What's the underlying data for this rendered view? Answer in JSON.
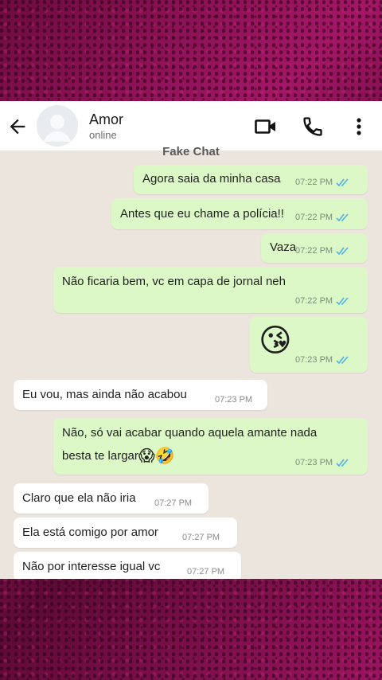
{
  "contact": {
    "name": "Amor",
    "status": "online"
  },
  "overlay_label": "Fake Chat",
  "messages": [
    {
      "dir": "out",
      "text": "Agora saia da minha casa",
      "time": "07:22 PM"
    },
    {
      "dir": "out",
      "text": "Antes que eu chame a polícia!!",
      "time": "07:22 PM"
    },
    {
      "dir": "out",
      "text": "Vaza",
      "time": "07:22 PM"
    },
    {
      "dir": "out",
      "text": "Não ficaria bem, vc em capa de jornal neh",
      "time": "07:22 PM"
    },
    {
      "dir": "out",
      "emoji": "😘",
      "time": "07:23 PM"
    },
    {
      "dir": "in",
      "text": "Eu vou, mas ainda não acabou",
      "time": "07:23 PM"
    },
    {
      "dir": "out",
      "line1": "Não, só vai acabar quando aquela amante nada",
      "line2": "besta te largar",
      "emoji": "😱🤣",
      "time": "07:23 PM"
    },
    {
      "dir": "in",
      "text": "Claro que ela não iria",
      "time": "07:27 PM"
    },
    {
      "dir": "in",
      "text": "Ela está comigo por amor",
      "time": "07:27 PM"
    },
    {
      "dir": "in",
      "text": "Não por interesse igual vc",
      "time": "07:27 PM"
    }
  ],
  "colors": {
    "outgoing_bubble": "#dcf8c6",
    "incoming_bubble": "#ffffff",
    "chat_bg": "#ece5dd",
    "read_ticks": "#4fb3e8",
    "frame": "#8a1253"
  },
  "icons": [
    "back-arrow-icon",
    "avatar-placeholder-icon",
    "video-call-icon",
    "phone-icon",
    "more-options-icon",
    "double-check-icon"
  ]
}
